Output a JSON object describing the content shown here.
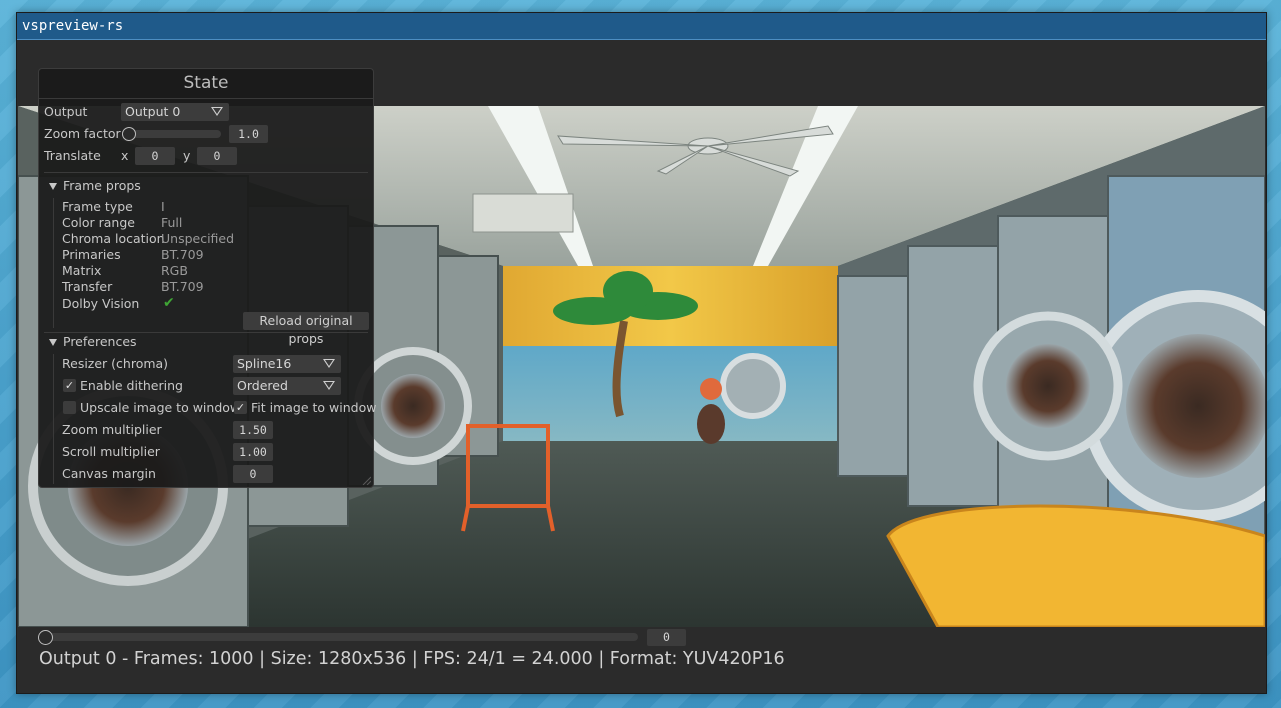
{
  "window": {
    "title": "vspreview-rs"
  },
  "panel": {
    "title": "State",
    "output_label": "Output",
    "output_value": "Output 0",
    "zoom_label": "Zoom factor",
    "zoom_value": "1.0",
    "translate_label": "Translate",
    "translate_x_label": "x",
    "translate_x_value": "0",
    "translate_y_label": "y",
    "translate_y_value": "0",
    "frame_props": {
      "header": "Frame props",
      "items": [
        {
          "key": "Frame type",
          "value": "I"
        },
        {
          "key": "Color range",
          "value": "Full"
        },
        {
          "key": "Chroma location",
          "value": "Unspecified"
        },
        {
          "key": "Primaries",
          "value": "BT.709"
        },
        {
          "key": "Matrix",
          "value": "RGB"
        },
        {
          "key": "Transfer",
          "value": "BT.709"
        },
        {
          "key": "Dolby Vision",
          "value": "✔"
        }
      ],
      "reload_button": "Reload original props"
    },
    "preferences": {
      "header": "Preferences",
      "resizer_label": "Resizer (chroma)",
      "resizer_value": "Spline16",
      "dithering_label": "Enable dithering",
      "dithering_checked": "✓",
      "dithering_value": "Ordered",
      "upscale_label": "Upscale image to window",
      "fit_label": "Fit image to window",
      "fit_checked": "✓",
      "zoom_mult_label": "Zoom multiplier",
      "zoom_mult_value": "1.50",
      "scroll_mult_label": "Scroll multiplier",
      "scroll_mult_value": "1.00",
      "canvas_margin_label": "Canvas margin",
      "canvas_margin_value": "0"
    }
  },
  "timeline": {
    "frame_value": "0",
    "status": "Output 0 - Frames: 1000 | Size: 1280x536 | FPS: 24/1 = 24.000 | Format: YUV420P16"
  },
  "colors": {
    "titlebar": "#1f5a8a",
    "window_bg": "#2b2b2b",
    "panel_bg": "#1b1b1b",
    "check_green": "#3fa535"
  }
}
